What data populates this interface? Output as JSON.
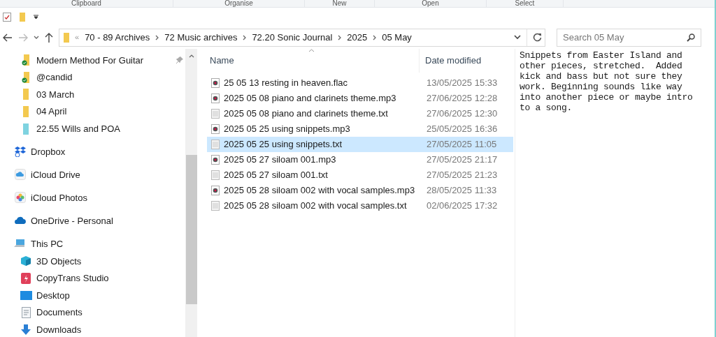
{
  "ribbon_groups": [
    "Clipboard",
    "Organise",
    "New",
    "Open",
    "Select"
  ],
  "address_bar": {
    "overflow": "«",
    "crumbs": [
      "70 - 89 Archives",
      "72 Music archives",
      "72.20 Sonic Journal",
      "2025",
      "05 May"
    ]
  },
  "search": {
    "placeholder": "Search 05 May"
  },
  "sidebar": {
    "pinned_items": [
      {
        "label": "Modern Method For Guitar",
        "kind": "synced-folder",
        "pinned": true
      },
      {
        "label": "@candid",
        "kind": "synced-folder",
        "pinned": false
      },
      {
        "label": "03 March",
        "kind": "folder",
        "pinned": false
      },
      {
        "label": "04 April",
        "kind": "folder",
        "pinned": false
      },
      {
        "label": "22.55 Wills and POA",
        "kind": "blue-folder",
        "pinned": false
      }
    ],
    "items": [
      {
        "label": "Dropbox",
        "kind": "dropbox"
      },
      {
        "label": "iCloud Drive",
        "kind": "icloud"
      },
      {
        "label": "iCloud Photos",
        "kind": "photos"
      },
      {
        "label": "OneDrive - Personal",
        "kind": "onedrive"
      },
      {
        "label": "This PC",
        "kind": "pc",
        "children": [
          {
            "label": "3D Objects",
            "kind": "cube"
          },
          {
            "label": "CopyTrans Studio",
            "kind": "copytrans"
          },
          {
            "label": "Desktop",
            "kind": "desktop"
          },
          {
            "label": "Documents",
            "kind": "documents"
          },
          {
            "label": "Downloads",
            "kind": "downloads"
          }
        ]
      }
    ]
  },
  "file_list": {
    "columns": [
      "Name",
      "Date modified"
    ],
    "rows": [
      {
        "name": "25 05 13 resting in heaven.flac",
        "date": "13/05/2025 15:33",
        "kind": "audio",
        "selected": false
      },
      {
        "name": "2025 05 08 piano and clarinets theme.mp3",
        "date": "27/06/2025 12:28",
        "kind": "audio",
        "selected": false
      },
      {
        "name": "2025 05 08 piano and clarinets theme.txt",
        "date": "27/06/2025 12:30",
        "kind": "text",
        "selected": false
      },
      {
        "name": "2025 05 25 using snippets.mp3",
        "date": "25/05/2025 16:36",
        "kind": "audio",
        "selected": false
      },
      {
        "name": "2025 05 25 using snippets.txt",
        "date": "27/05/2025 11:05",
        "kind": "text",
        "selected": true
      },
      {
        "name": "2025 05 27 siloam 001.mp3",
        "date": "27/05/2025 21:17",
        "kind": "audio",
        "selected": false
      },
      {
        "name": "2025 05 27 siloam 001.txt",
        "date": "27/05/2025 21:23",
        "kind": "text",
        "selected": false
      },
      {
        "name": "2025 05 28 siloam 002 with vocal samples.mp3",
        "date": "28/05/2025 11:33",
        "kind": "audio",
        "selected": false
      },
      {
        "name": "2025 05 28 siloam 002 with vocal samples.txt",
        "date": "02/06/2025 17:32",
        "kind": "text",
        "selected": false
      }
    ]
  },
  "preview": {
    "text": "Snippets from Easter Island and other pieces, stretched.  Added kick and bass but not sure they work. Beginning sounds like way into another piece or maybe intro to a song."
  }
}
